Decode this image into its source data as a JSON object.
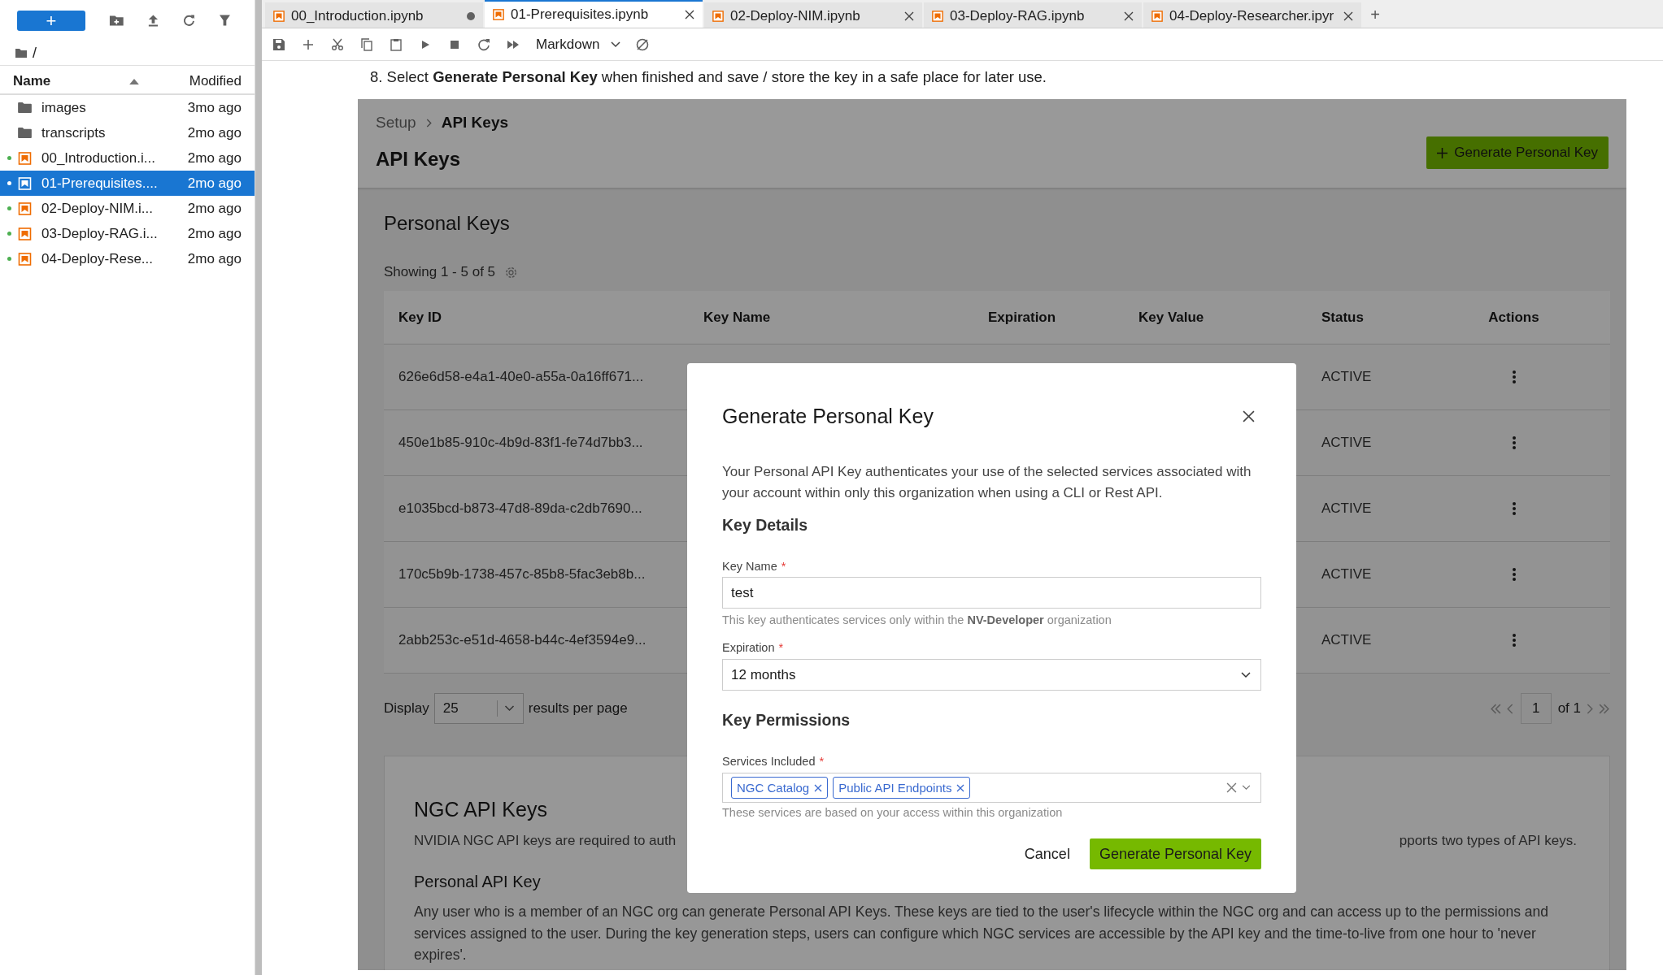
{
  "sidebar": {
    "new_button": "+",
    "path": "/",
    "columns": [
      "Name",
      "Modified"
    ],
    "items": [
      {
        "kind": "folder",
        "name": "images",
        "modified": "3mo ago",
        "selected": false,
        "open": false
      },
      {
        "kind": "folder",
        "name": "transcripts",
        "modified": "2mo ago",
        "selected": false,
        "open": false
      },
      {
        "kind": "notebook",
        "name": "00_Introduction.i...",
        "modified": "2mo ago",
        "selected": false,
        "open": true
      },
      {
        "kind": "notebook",
        "name": "01-Prerequisites....",
        "modified": "2mo ago",
        "selected": true,
        "open": true
      },
      {
        "kind": "notebook",
        "name": "02-Deploy-NIM.i...",
        "modified": "2mo ago",
        "selected": false,
        "open": true
      },
      {
        "kind": "notebook",
        "name": "03-Deploy-RAG.i...",
        "modified": "2mo ago",
        "selected": false,
        "open": true
      },
      {
        "kind": "notebook",
        "name": "04-Deploy-Rese...",
        "modified": "2mo ago",
        "selected": false,
        "open": true
      }
    ]
  },
  "tabs": [
    {
      "label": "00_Introduction.ipynb",
      "selected": false,
      "unsaved": true
    },
    {
      "label": "01-Prerequisites.ipynb",
      "selected": true,
      "unsaved": false
    },
    {
      "label": "02-Deploy-NIM.ipynb",
      "selected": false,
      "unsaved": false
    },
    {
      "label": "03-Deploy-RAG.ipynb",
      "selected": false,
      "unsaved": false
    },
    {
      "label": "04-Deploy-Researcher.ipyr",
      "selected": false,
      "unsaved": false
    }
  ],
  "new_tab": "+",
  "toolbar": {
    "cell_type": "Markdown"
  },
  "cell_text": "8. Select **Generate Personal Key** when finished and save / store the key in a safe place for later use.",
  "embedded": {
    "breadcrumb": [
      "Setup",
      "API Keys"
    ],
    "page_title": "API Keys",
    "generate_button": "Generate Personal Key",
    "section_title": "Personal Keys",
    "showing": "Showing 1 - 5 of 5",
    "columns": [
      "Key ID",
      "Key Name",
      "Expiration",
      "Key Value",
      "Status",
      "Actions"
    ],
    "rows": [
      {
        "key_id": "626e6d58-e4a1-40e0-a55a-0a16ff671...",
        "status": "ACTIVE"
      },
      {
        "key_id": "450e1b85-910c-4b9d-83f1-fe74d7bb3...",
        "status": "ACTIVE"
      },
      {
        "key_id": "e1035bcd-b873-47d8-89da-c2db7690...",
        "status": "ACTIVE"
      },
      {
        "key_id": "170c5b9b-1738-457c-85b8-5fac3eb8b...",
        "status": "ACTIVE"
      },
      {
        "key_id": "2abb253c-e51d-4658-b44c-4ef3594e9...",
        "status": "ACTIVE"
      }
    ],
    "display_label": "Display",
    "page_size": "25",
    "per_page": "results per page",
    "page": "1",
    "page_of": "of 1",
    "ngc": {
      "title": "NGC API Keys",
      "intro_left": "NVIDIA NGC API keys are required to auth",
      "intro_right": "pports two types of API keys.",
      "subtitle": "Personal API Key",
      "body": "Any user who is a member of an NGC org can generate Personal API Keys. These keys are tied to the user's lifecycle within the NGC org and can access up to the permissions and services assigned to the user. During the key generation steps, users can configure which NGC services are accessible by the API key and the time-to-live from one hour to 'never expires'."
    }
  },
  "modal": {
    "title": "Generate Personal Key",
    "description": "Your Personal API Key authenticates your use of the selected services associated with your account within only this organization when using a CLI or Rest API.",
    "details_heading": "Key Details",
    "key_name": {
      "label": "Key Name",
      "required_mark": "*",
      "value": "test",
      "help": "This key authenticates services only within the **NV-Developer** organization"
    },
    "expiration": {
      "label": "Expiration",
      "required_mark": "*",
      "value": "12 months"
    },
    "permissions_heading": "Key Permissions",
    "services": {
      "label": "Services Included",
      "required_mark": "*",
      "chips": [
        "NGC Catalog",
        "Public API Endpoints"
      ],
      "help": "These services are based on your access within this organization"
    },
    "cancel": "Cancel",
    "submit": "Generate Personal Key"
  }
}
